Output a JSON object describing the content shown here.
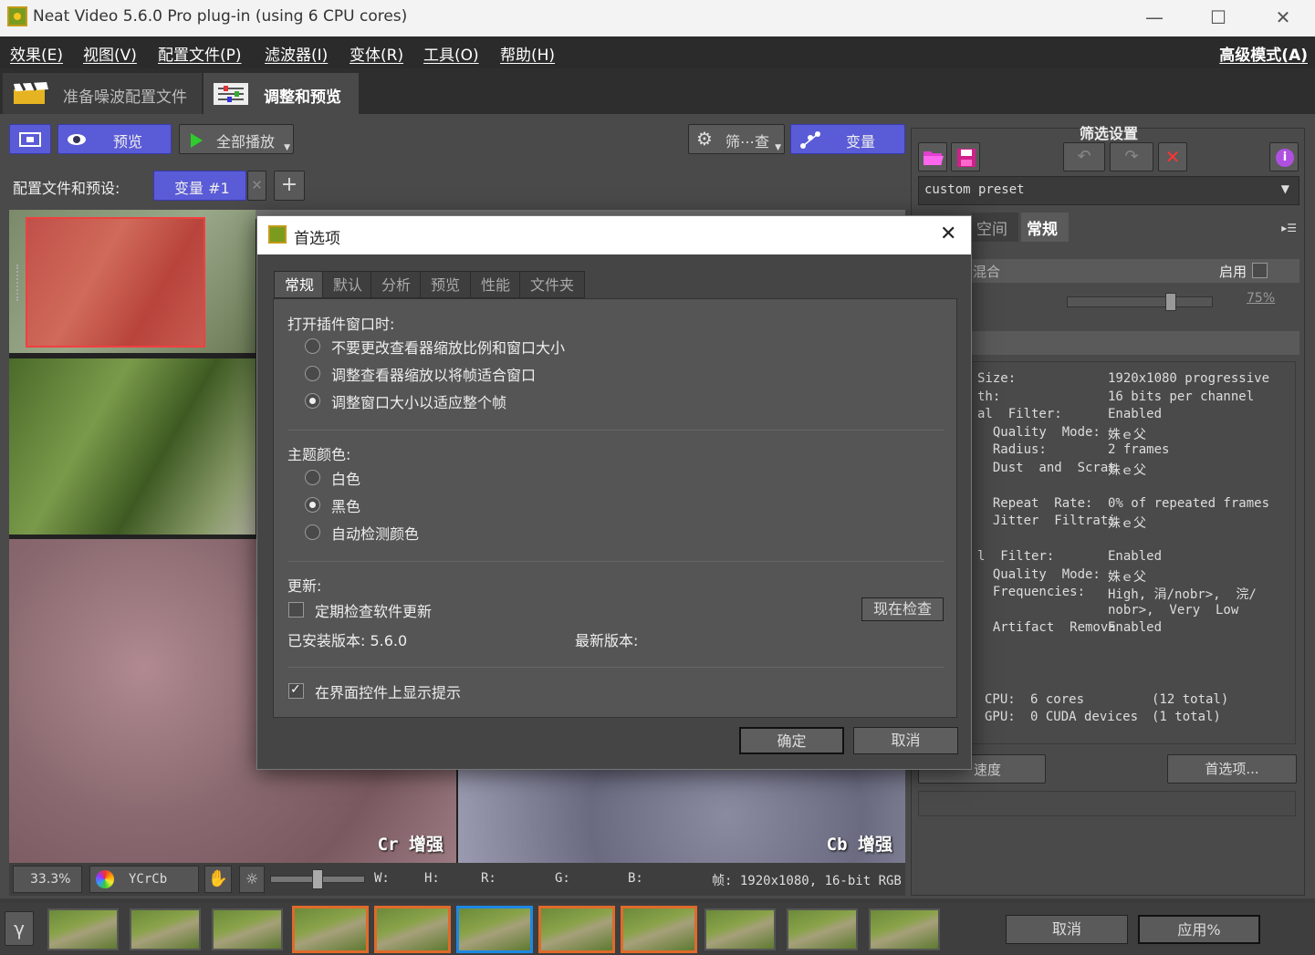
{
  "window": {
    "title": "Neat Video 5.6.0 Pro plug-in (using 6 CPU cores)",
    "minimize": "—",
    "maximize": "☐",
    "close": "✕"
  },
  "menu": {
    "items": [
      "效果(E)",
      "视图(V)",
      "配置文件(P)",
      "滤波器(I)",
      "变体(R)",
      "工具(O)",
      "帮助(H)"
    ],
    "advanced": "高级模式(A)"
  },
  "tabs": {
    "prepare": "准备噪波配置文件",
    "adjust": "调整和预览"
  },
  "toolbar": {
    "preview": "预览",
    "play_all": "全部播放",
    "filter_check": "筛⋯查",
    "variant": "变量"
  },
  "profile": {
    "label": "配置文件和预设:",
    "variant_tab": "变量 #1",
    "close": "✕",
    "add": "+"
  },
  "viewer": {
    "cr_label": "Cr 增强",
    "cb_label": "Cb 增强"
  },
  "statusbar": {
    "zoom": "33.3%",
    "colorspace": "YCrCb",
    "w": "W:",
    "h": "H:",
    "r": "R:",
    "g": "G:",
    "b": "B:",
    "frame": "帧: 1920x1080, 16-bit RGB"
  },
  "right_panel": {
    "title": "筛选设置",
    "preset": "custom preset",
    "tab_space": "空间",
    "tab_general": "常规",
    "mix_label": "混合",
    "enable_label": "启用",
    "slider_value": "75%",
    "info": [
      [
        "Size:",
        "1920x1080 progressive"
      ],
      [
        "th:",
        "16 bits per channel"
      ],
      [
        "al  Filter:",
        "Enabled"
      ],
      [
        "  Quality  Mode:",
        "姝ｅ父"
      ],
      [
        "  Radius:",
        "2 frames"
      ],
      [
        "  Dust  and  Scrat",
        "姝ｅ父"
      ],
      [
        "",
        ""
      ],
      [
        "  Repeat  Rate:",
        "0% of repeated frames"
      ],
      [
        "  Jitter  Filtrati",
        "姝ｅ父"
      ],
      [
        "",
        ""
      ],
      [
        "l  Filter:",
        "Enabled"
      ],
      [
        "  Quality  Mode:",
        "姝ｅ父"
      ],
      [
        "  Frequencies:",
        "High, 涓/nobr>,  浣/"
      ],
      [
        "",
        "nobr>,  Very  Low"
      ],
      [
        "  Artifact  Remova",
        "Enabled"
      ]
    ],
    "cpu_label": "CPU:",
    "cpu_value": "6 cores",
    "cpu_total": "(12 total)",
    "gpu_label": "GPU:",
    "gpu_value": "0 CUDA devices",
    "gpu_total": "(1 total)",
    "speed_button": "速度",
    "prefs_button": "首选项..."
  },
  "bottom": {
    "gamma": "γ",
    "cancel": "取消",
    "apply": "应用%"
  },
  "dialog": {
    "title": "首选项",
    "close": "✕",
    "tabs": [
      "常规",
      "默认",
      "分析",
      "预览",
      "性能",
      "文件夹"
    ],
    "open_section": "打开插件窗口时:",
    "open_options": [
      "不要更改查看器缩放比例和窗口大小",
      "调整查看器缩放以将帧适合窗口",
      "调整窗口大小以适应整个帧"
    ],
    "theme_section": "主题颜色:",
    "theme_options": [
      "白色",
      "黑色",
      "自动检测颜色"
    ],
    "update_section": "更新:",
    "update_check": "定期检查软件更新",
    "check_now": "现在检查",
    "installed": "已安装版本: 5.6.0",
    "latest": "最新版本:",
    "tooltips": "在界面控件上显示提示",
    "ok": "确定",
    "cancel": "取消"
  },
  "colors": {
    "accent_blue": "#5a5bd6",
    "selection_orange": "#e06a2a",
    "current_blue": "#1e88e5"
  }
}
